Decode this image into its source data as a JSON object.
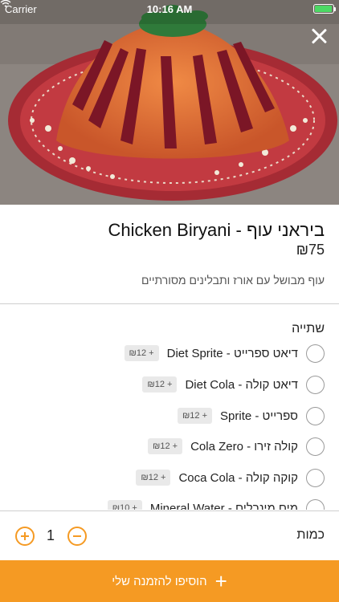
{
  "status_bar": {
    "carrier": "Carrier",
    "time": "10:16 AM",
    "battery_level": 0.95,
    "battery_color": "#4cd964"
  },
  "header": {
    "close_icon": "close-icon"
  },
  "dish": {
    "title": "ביראני עוף - Chicken Biryani",
    "price": "₪75",
    "description": "עוף מבושל עם אורז ותבלינים מסורתיים"
  },
  "options": {
    "group_title": "שתייה",
    "items": [
      {
        "label": "דיאט ספרייט - Diet Sprite",
        "price": "₪12 +"
      },
      {
        "label": "דיאט קולה - Diet Cola",
        "price": "₪12 +"
      },
      {
        "label": "ספרייט - Sprite",
        "price": "₪12 +"
      },
      {
        "label": "קולה זירו - Cola Zero",
        "price": "₪12 +"
      },
      {
        "label": "קוקה קולה - Coca Cola",
        "price": "₪12 +"
      },
      {
        "label": "מים מינרלים - Mineral Water",
        "price": "₪10 +"
      }
    ]
  },
  "quantity": {
    "label": "כמות",
    "value": "1"
  },
  "add_button": {
    "label": "הוסיפו להזמנה שלי",
    "icon": "plus-icon"
  },
  "colors": {
    "accent": "#f59a23",
    "dish_plate": "#b5333b",
    "rice": "#e0763a"
  }
}
